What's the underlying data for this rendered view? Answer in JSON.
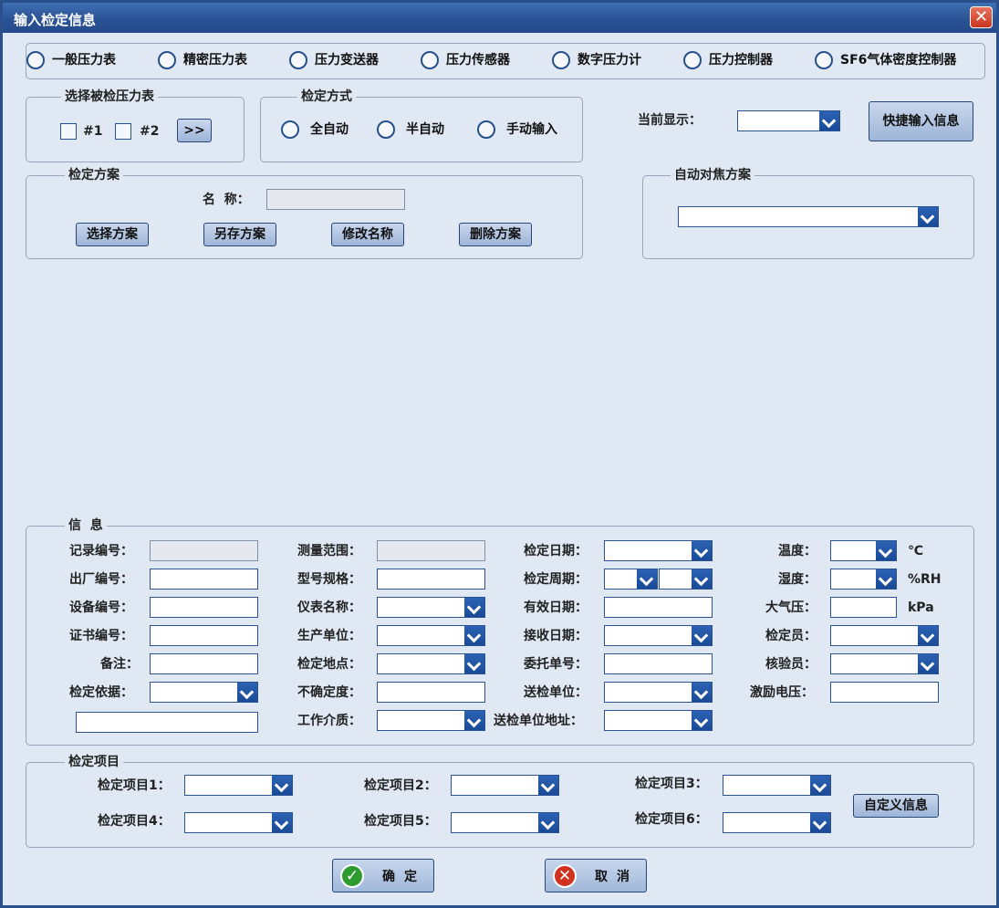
{
  "title": "输入检定信息",
  "close_icon": "✕",
  "instrument_types": [
    "一般压力表",
    "精密压力表",
    "压力变送器",
    "压力传感器",
    "数字压力计",
    "压力控制器",
    "SF6气体密度控制器"
  ],
  "select_gauge": {
    "legend": "选择被检压力表",
    "items": [
      "#1",
      "#2"
    ],
    "more_button": ">>"
  },
  "method": {
    "legend": "检定方式",
    "options": [
      "全自动",
      "半自动",
      "手动输入"
    ]
  },
  "current_display": {
    "label": "当前显示：",
    "value": ""
  },
  "quick_input_button": "快捷输入信息",
  "scheme": {
    "legend": "检定方案",
    "name_label": "名  称：",
    "name_value": "",
    "buttons": [
      "选择方案",
      "另存方案",
      "修改名称",
      "删除方案"
    ]
  },
  "autofocus": {
    "legend": "自动对焦方案",
    "value": ""
  },
  "info": {
    "legend": "信  息",
    "col1": [
      "记录编号：",
      "出厂编号：",
      "设备编号：",
      "证书编号：",
      "备注：",
      "检定依据："
    ],
    "col2": [
      "测量范围：",
      "型号规格：",
      "仪表名称：",
      "生产单位：",
      "检定地点：",
      "不确定度：",
      "工作介质："
    ],
    "col3": [
      "检定日期：",
      "检定周期：",
      "有效日期：",
      "接收日期：",
      "委托单号：",
      "送检单位：",
      "送检单位地址："
    ],
    "col4": [
      "温度：",
      "湿度：",
      "大气压：",
      "检定员：",
      "核验员：",
      "激励电压："
    ],
    "units": [
      "℃",
      "%RH",
      "kPa"
    ]
  },
  "items": {
    "legend": "检定项目",
    "labels": [
      "检定项目1：",
      "检定项目2：",
      "检定项目3：",
      "检定项目4：",
      "检定项目5：",
      "检定项目6："
    ],
    "custom_button": "自定义信息"
  },
  "confirm_button": "确定",
  "cancel_button": "取消"
}
